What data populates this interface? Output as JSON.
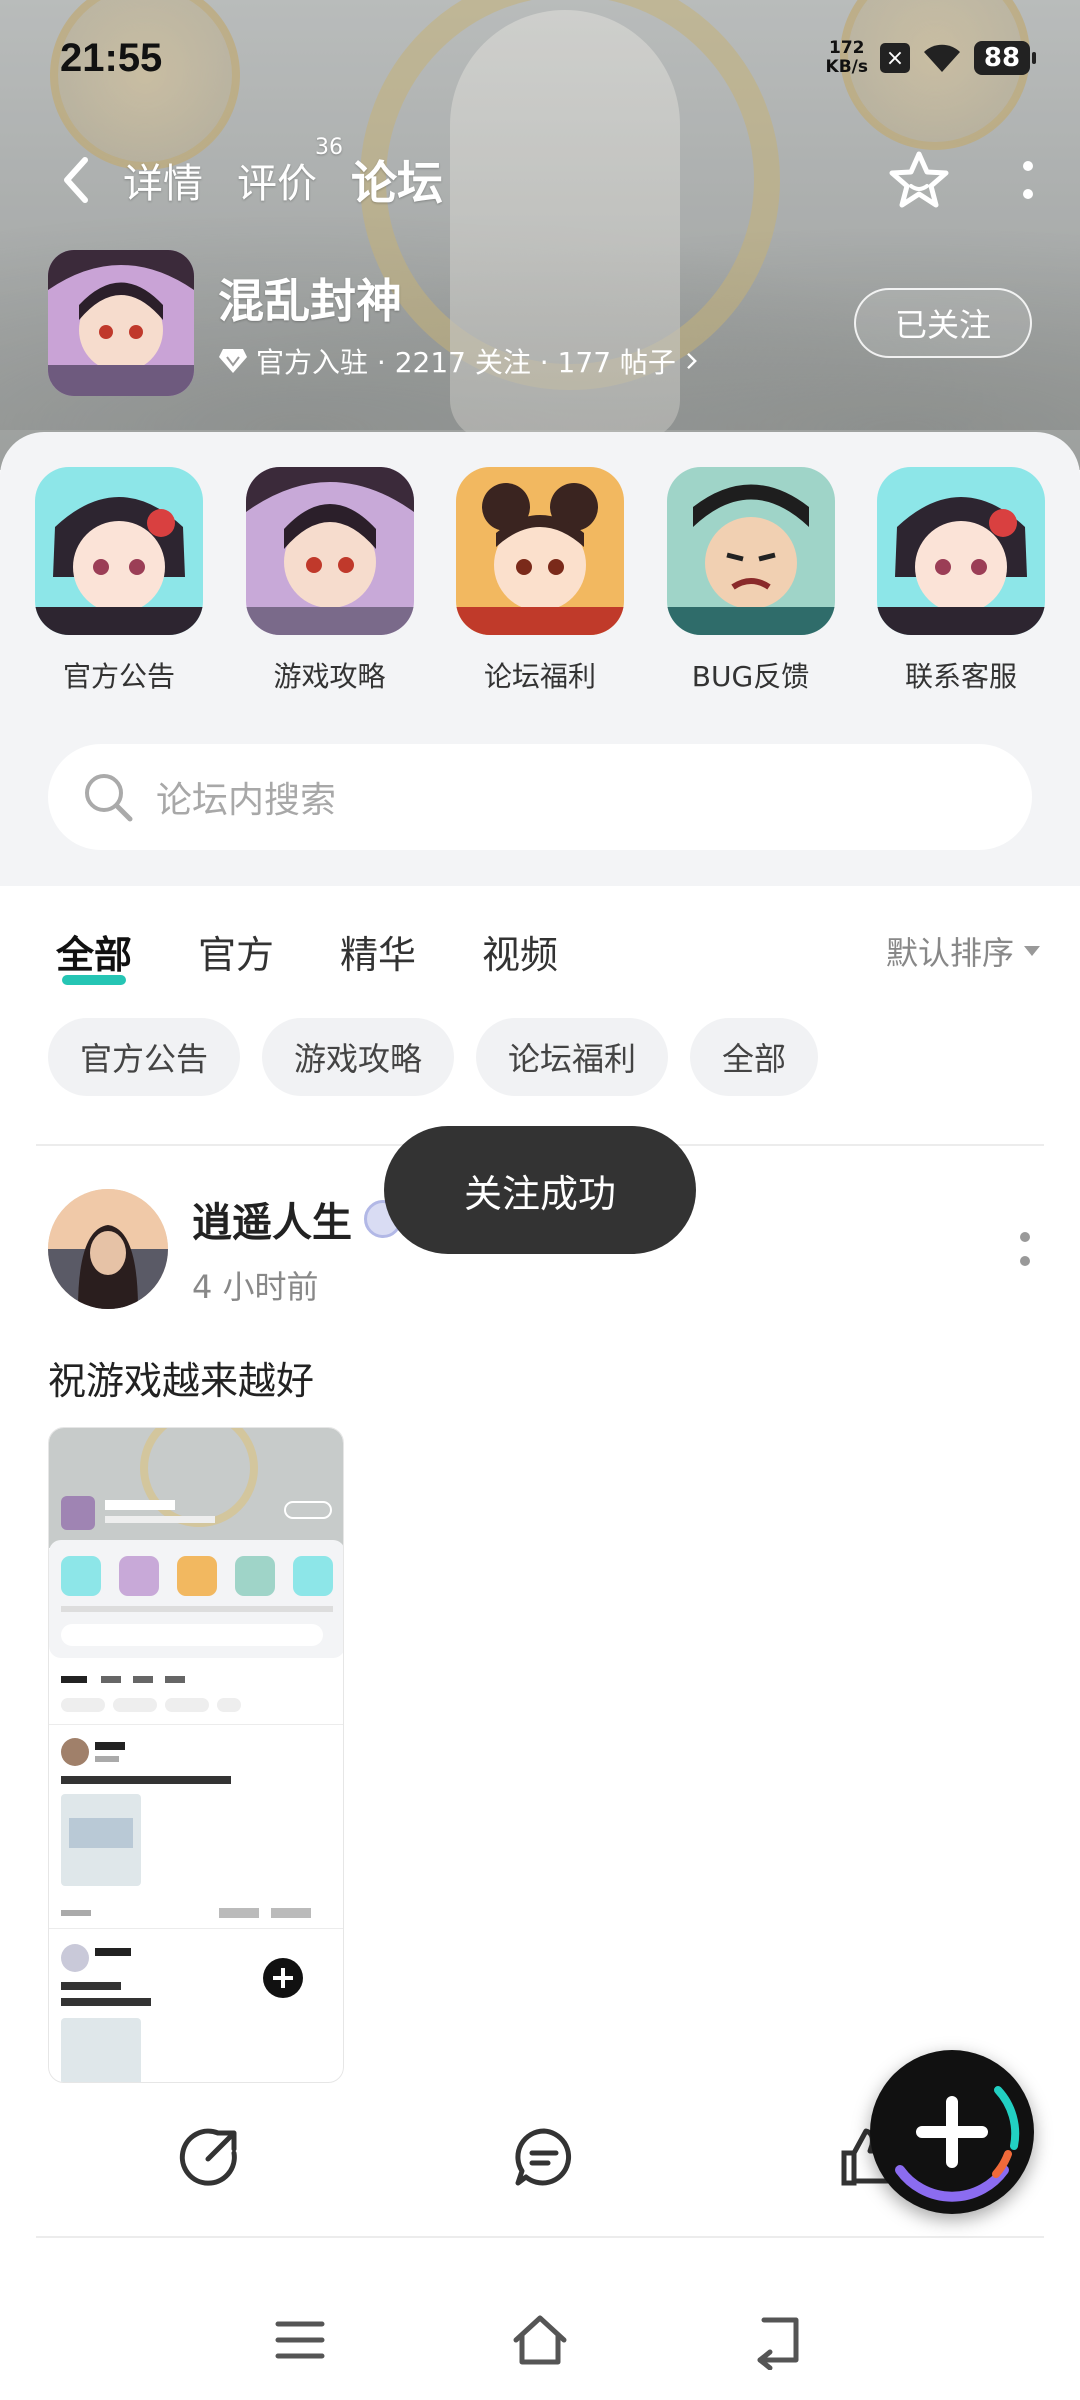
{
  "status_bar": {
    "time": "21:55",
    "net_speed_value": "172",
    "net_speed_unit": "KB/s",
    "battery": "88"
  },
  "nav": {
    "tabs": [
      {
        "label": "详情"
      },
      {
        "label": "评价",
        "badge": "36"
      },
      {
        "label": "论坛"
      }
    ],
    "active_tab": "论坛"
  },
  "game": {
    "title": "混乱封神",
    "meta": "官方入驻 · 2217 关注 · 177 帖子",
    "follow_label": "已关注"
  },
  "quick_links": [
    {
      "label": "官方公告"
    },
    {
      "label": "游戏攻略"
    },
    {
      "label": "论坛福利"
    },
    {
      "label": "BUG反馈"
    },
    {
      "label": "联系客服"
    }
  ],
  "search": {
    "placeholder": "论坛内搜索"
  },
  "filter_tabs": [
    {
      "label": "全部"
    },
    {
      "label": "官方"
    },
    {
      "label": "精华"
    },
    {
      "label": "视频"
    }
  ],
  "active_filter": "全部",
  "sort_label": "默认排序",
  "chips": [
    {
      "label": "官方公告"
    },
    {
      "label": "游戏攻略"
    },
    {
      "label": "论坛福利"
    },
    {
      "label": "全部"
    }
  ],
  "post": {
    "user": "逍遥人生",
    "time": "4 小时前",
    "text": "祝游戏越来越好"
  },
  "toast": "关注成功",
  "colors": {
    "accent": "#25c5b4",
    "toast_bg": "#333333",
    "panel_bg": "#f3f4f6"
  },
  "icons": [
    "back-icon",
    "star-icon",
    "more-icon",
    "search-icon",
    "share-icon",
    "comment-icon",
    "like-icon",
    "plus-icon",
    "menu-icon",
    "home-icon",
    "back-nav-icon"
  ]
}
